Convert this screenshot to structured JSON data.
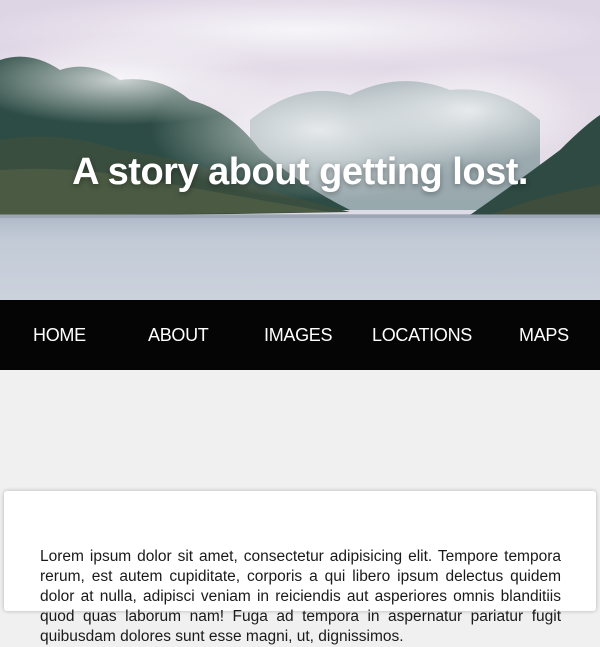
{
  "hero": {
    "title": "A story about getting lost."
  },
  "nav": {
    "items": [
      {
        "label": "HOME"
      },
      {
        "label": "ABOUT"
      },
      {
        "label": "IMAGES"
      },
      {
        "label": "LOCATIONS"
      },
      {
        "label": "MAPS"
      }
    ]
  },
  "content": {
    "paragraph": "Lorem ipsum dolor sit amet, consectetur adipisicing elit. Tempore tempora rerum, est autem cupiditate, corporis a qui libero ipsum delectus quidem dolor at nulla, adipisci veniam in reiciendis aut asperiores omnis blanditiis quod quas laborum nam! Fuga ad tempora in aspernatur pariatur fugit quibusdam dolores sunt esse magni, ut, dignissimos."
  },
  "colors": {
    "nav_background": "#050505",
    "page_background": "#f0f0f0",
    "card_background": "#ffffff",
    "hero_text": "#ffffff"
  }
}
